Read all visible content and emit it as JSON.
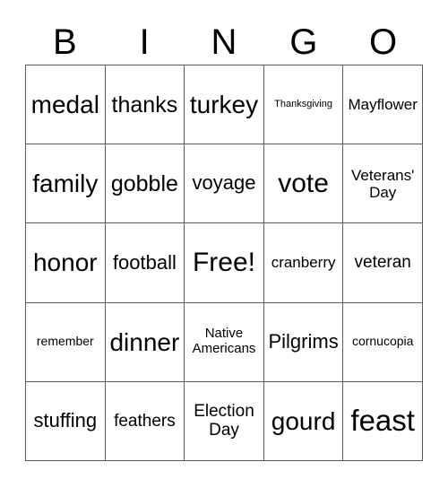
{
  "card": {
    "title": "BINGO",
    "header_letters": [
      "B",
      "I",
      "N",
      "G",
      "O"
    ],
    "columns": 5,
    "rows": 5,
    "free_space_label": "Free!",
    "free_space_position": {
      "row": 3,
      "column": 3
    },
    "colors": {
      "background": "#ffffff",
      "text": "#000000",
      "grid_line": "#5a5a5a"
    },
    "cells": [
      {
        "text": "medal",
        "size": "fs-2xl",
        "row": 1,
        "col": 1
      },
      {
        "text": "thanks",
        "size": "fs-xl",
        "row": 1,
        "col": 2
      },
      {
        "text": "turkey",
        "size": "fs-2xl",
        "row": 1,
        "col": 3
      },
      {
        "text": "Thanksgiving",
        "size": "fs-xs",
        "row": 1,
        "col": 4
      },
      {
        "text": "Mayflower",
        "size": "fs-md",
        "row": 1,
        "col": 5
      },
      {
        "text": "family",
        "size": "fs-2xl",
        "row": 2,
        "col": 1
      },
      {
        "text": "gobble",
        "size": "fs-xl",
        "row": 2,
        "col": 2
      },
      {
        "text": "voyage",
        "size": "fs-lg",
        "row": 2,
        "col": 3
      },
      {
        "text": "vote",
        "size": "fs-3xl",
        "row": 2,
        "col": 4
      },
      {
        "text": "Veterans' Day",
        "size": "fs-md",
        "row": 2,
        "col": 5
      },
      {
        "text": "honor",
        "size": "fs-2xl",
        "row": 3,
        "col": 1
      },
      {
        "text": "football",
        "size": "fs-lg",
        "row": 3,
        "col": 2
      },
      {
        "text": "Free!",
        "size": "fs-3xl",
        "row": 3,
        "col": 3
      },
      {
        "text": "cranberry",
        "size": "fs-md",
        "row": 3,
        "col": 4
      },
      {
        "text": "veteran",
        "size": "fs-mdl",
        "row": 3,
        "col": 5
      },
      {
        "text": "remember",
        "size": "fs-sm",
        "row": 4,
        "col": 1
      },
      {
        "text": "dinner",
        "size": "fs-2xl",
        "row": 4,
        "col": 2
      },
      {
        "text": "Native Americans",
        "size": "fs-smm",
        "row": 4,
        "col": 3
      },
      {
        "text": "Pilgrims",
        "size": "fs-lg",
        "row": 4,
        "col": 4
      },
      {
        "text": "cornucopia",
        "size": "fs-sm",
        "row": 4,
        "col": 5
      },
      {
        "text": "stuffing",
        "size": "fs-lg",
        "row": 5,
        "col": 1
      },
      {
        "text": "feathers",
        "size": "fs-mdl",
        "row": 5,
        "col": 2
      },
      {
        "text": "Election Day",
        "size": "fs-mdl",
        "row": 5,
        "col": 3
      },
      {
        "text": "gourd",
        "size": "fs-2xl",
        "row": 5,
        "col": 4
      },
      {
        "text": "feast",
        "size": "fs-4xl",
        "row": 5,
        "col": 5
      }
    ]
  }
}
